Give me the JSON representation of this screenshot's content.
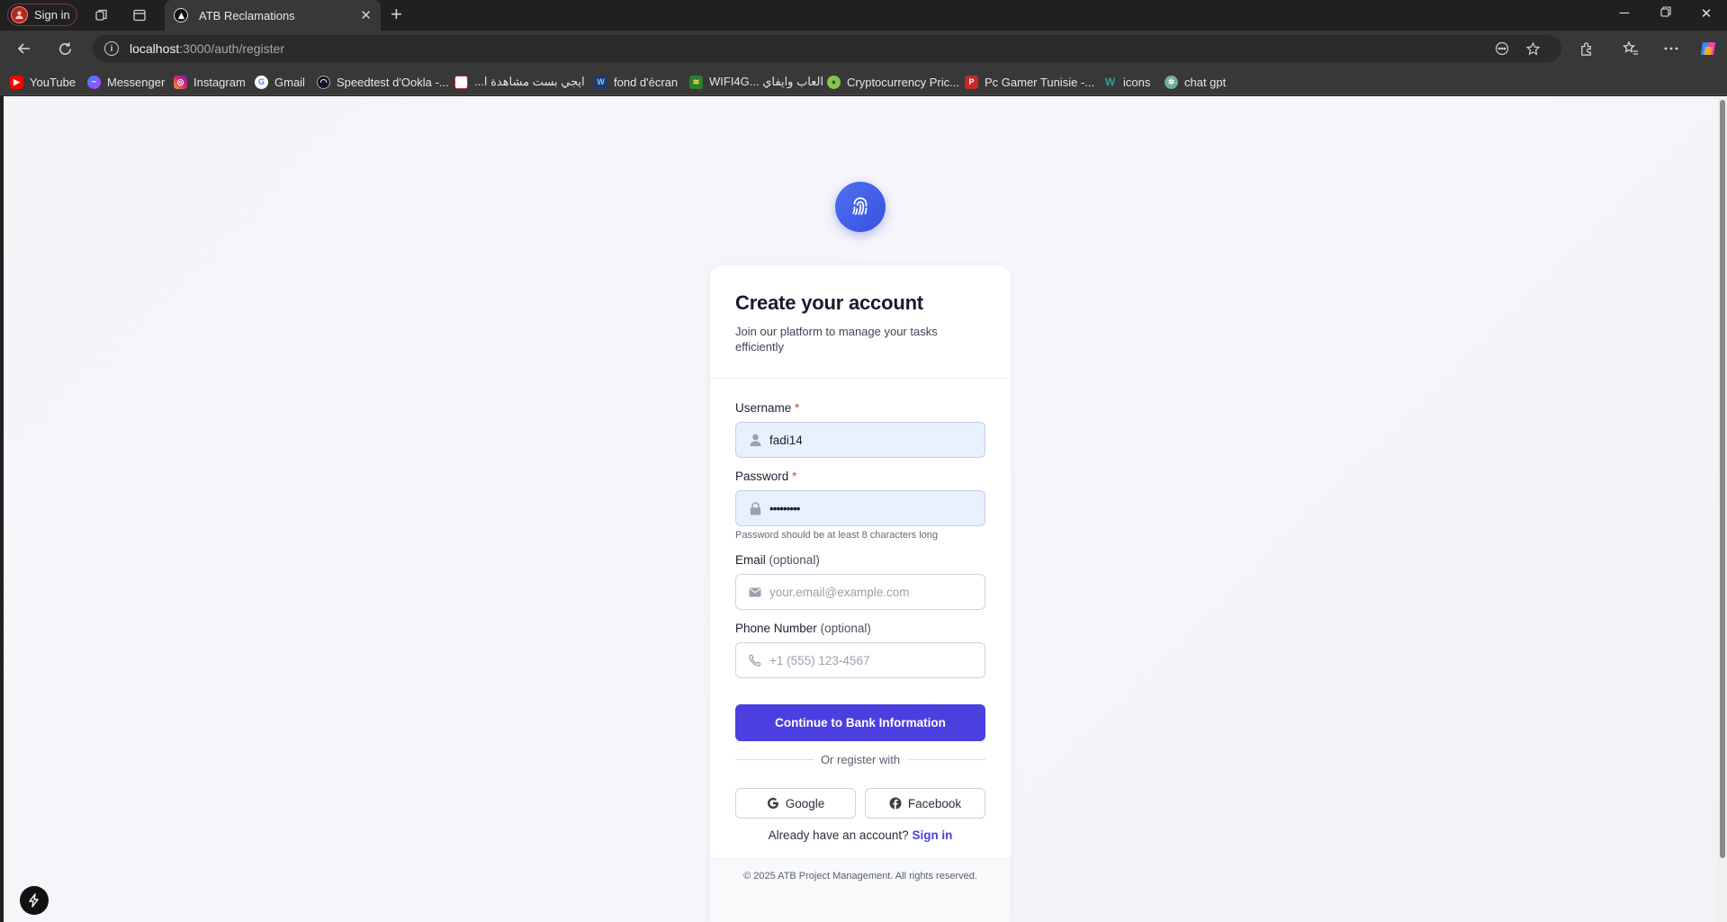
{
  "browser": {
    "profile_label": "Sign in",
    "tab_title": "ATB Reclamations",
    "url_host": "localhost",
    "url_path": ":3000/auth/register",
    "bookmarks": [
      {
        "label": "YouTube",
        "icon": "youtube-icon",
        "color": "#ff0000"
      },
      {
        "label": "Messenger",
        "icon": "messenger-icon",
        "color": "#8a3ffc"
      },
      {
        "label": "Instagram",
        "icon": "instagram-icon",
        "color": "#d62976"
      },
      {
        "label": "Gmail",
        "icon": "google-icon",
        "color": "#ffffff"
      },
      {
        "label": "Speedtest d'Ookla -...",
        "icon": "speedtest-icon",
        "color": "#141526"
      },
      {
        "label": "...ايجي بست مشاهدة ا",
        "icon": "egybest-icon",
        "color": "#ffffff"
      },
      {
        "label": "fond d'écran",
        "icon": "wallpaper-icon",
        "color": "#3d7bd6"
      },
      {
        "label": "WIFI4G... العاب وايفاي",
        "icon": "wifi4g-icon",
        "color": "#2e7d32"
      },
      {
        "label": "Cryptocurrency Pric...",
        "icon": "coin-icon",
        "color": "#8bc34a"
      },
      {
        "label": "Pc Gamer Tunisie -...",
        "icon": "pcgamer-icon",
        "color": "#c62828"
      },
      {
        "label": "icons",
        "icon": "icons-icon",
        "color": "#00897b"
      },
      {
        "label": "chat gpt",
        "icon": "chatgpt-icon",
        "color": "#74aa9c"
      }
    ]
  },
  "page": {
    "title": "Create your account",
    "subtitle": "Join our platform to manage your tasks efficiently",
    "username": {
      "label": "Username",
      "required": "*",
      "value": "fadi14"
    },
    "password": {
      "label": "Password",
      "required": "*",
      "value": "•••••••••",
      "hint": "Password should be at least 8 characters long"
    },
    "email": {
      "label": "Email",
      "optional": "(optional)",
      "placeholder": "your.email@example.com"
    },
    "phone": {
      "label": "Phone Number",
      "optional": "(optional)",
      "placeholder": "+1 (555) 123-4567"
    },
    "continue_button": "Continue to Bank Information",
    "divider_text": "Or register with",
    "google_button": "Google",
    "facebook_button": "Facebook",
    "signin_prompt": "Already have an account?",
    "signin_link": "Sign in",
    "copyright": "© 2025 ATB Project Management. All rights reserved."
  },
  "colors": {
    "primary": "#4c3fe0",
    "logo": "#4361ee",
    "required": "#e53935",
    "autofill_bg": "#e8f0fe"
  }
}
